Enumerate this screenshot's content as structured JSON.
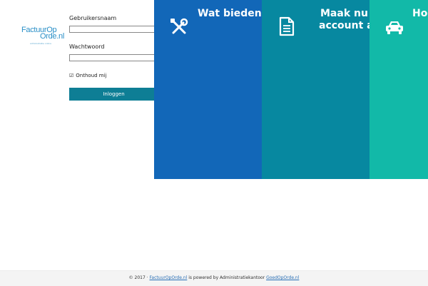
{
  "logo": {
    "line1": "FactuurOp",
    "line2": "Orde.nl",
    "tagline": "administratie online"
  },
  "login": {
    "username_label": "Gebruikersnaam",
    "username_value": "",
    "password_label": "Wachtwoord",
    "password_value": "",
    "remember_checked": true,
    "remember_label": "Onthoud mij",
    "submit_label": "Inloggen"
  },
  "panels": [
    {
      "title": "Wat bieden w",
      "icon": "tools-icon",
      "color": "#1267b8"
    },
    {
      "title_line1": "Maak nu e",
      "title_line2": "account a",
      "icon": "document-icon",
      "color": "#0788a0"
    },
    {
      "title": "Hoe",
      "icon": "car-icon",
      "color": "#12b9a8"
    }
  ],
  "footer": {
    "prefix": "© 2017 ·",
    "link1": "FactuurOpOrde.nl",
    "middle": "is powered by Administratiekantoor",
    "link2": "GoedOpOrde.nl"
  }
}
